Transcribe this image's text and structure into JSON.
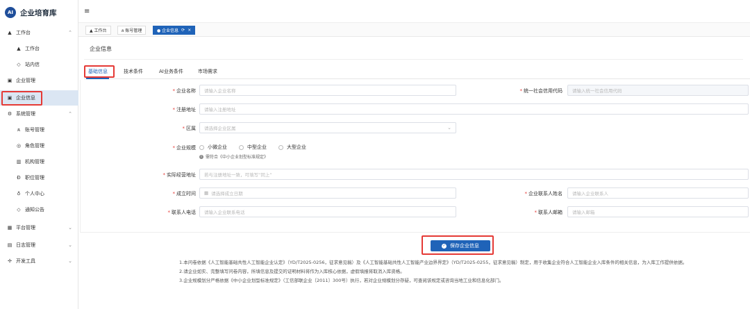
{
  "app": {
    "logo_mark": "AI",
    "title": "企业培育库"
  },
  "sidebar": {
    "items": [
      {
        "label": "工作台",
        "icon": "home-icon",
        "glyph": "▲",
        "chevron": "⌃"
      },
      {
        "label": "工作台",
        "icon": "home-icon",
        "glyph": "▲"
      },
      {
        "label": "站内信",
        "icon": "bell-icon",
        "glyph": "◇"
      },
      {
        "label": "企业管理",
        "icon": "id-card-icon",
        "glyph": "▣"
      },
      {
        "label": "企业信息",
        "icon": "id-card-icon",
        "glyph": "▣"
      },
      {
        "label": "系统管理",
        "icon": "gear-icon",
        "glyph": "⚙",
        "chevron": "⌃"
      },
      {
        "label": "账号管理",
        "icon": "user-icon",
        "glyph": "ጸ"
      },
      {
        "label": "角色管理",
        "icon": "role-icon",
        "glyph": "◎"
      },
      {
        "label": "机构管理",
        "icon": "org-icon",
        "glyph": "▥"
      },
      {
        "label": "职位管理",
        "icon": "position-icon",
        "glyph": "Ð"
      },
      {
        "label": "个人中心",
        "icon": "profile-icon",
        "glyph": "♁"
      },
      {
        "label": "通知公告",
        "icon": "notice-icon",
        "glyph": "◇"
      },
      {
        "label": "平台管理",
        "icon": "grid-icon",
        "glyph": "▦",
        "chevron": "⌄"
      },
      {
        "label": "日志管理",
        "icon": "log-icon",
        "glyph": "▤",
        "chevron": "⌄"
      },
      {
        "label": "开发工具",
        "icon": "tools-icon",
        "glyph": "✢",
        "chevron": "⌄"
      }
    ]
  },
  "topbar": {
    "menu_glyph": "≡"
  },
  "tabs": [
    {
      "label": "▲ 工作台"
    },
    {
      "label": "ጸ 账号管理"
    },
    {
      "label": "● 企业信息",
      "refresh": "⟳",
      "close": "×"
    }
  ],
  "page": {
    "title": "企业信息",
    "subtabs": [
      "基础信息",
      "技术条件",
      "AI业务条件",
      "市场需求"
    ]
  },
  "form": {
    "company_name": {
      "label": "企业名称",
      "placeholder": "请输入企业名称"
    },
    "credit_code": {
      "label": "统一社会信用代码",
      "placeholder": "请输入统一社会信用代码"
    },
    "reg_address": {
      "label": "注册地址",
      "placeholder": "请输入注册地址"
    },
    "district": {
      "label": "区属",
      "placeholder": "请选择企业区属",
      "arrow": "⌄"
    },
    "scale": {
      "label": "企业规模",
      "options": [
        "小微企业",
        "中型企业",
        "大型企业"
      ],
      "hint": "需符合《中小企业划型标准规定》",
      "hint_glyph": "i"
    },
    "actual_address": {
      "label": "实际经营地址",
      "placeholder": "若与注册地址一致，可填写“同上”"
    },
    "founded": {
      "label": "成立时间",
      "placeholder": "请选择成立日期",
      "glyph": "▦"
    },
    "contact_name": {
      "label": "企业联系人姓名",
      "placeholder": "请输入企业联系人"
    },
    "contact_phone": {
      "label": "联系人电话",
      "placeholder": "请输入企业联系电话"
    },
    "contact_email": {
      "label": "联系人邮箱",
      "placeholder": "请输入邮箱"
    },
    "required_mark": "*"
  },
  "actions": {
    "save_label": "保存企业信息",
    "save_glyph": "✓"
  },
  "notes": [
    "1.本问卷依据《人工智能基础共性人工智能企业认定》（YD/T2025-0256，征求意见稿）及《人工智能基础共性人工智能产业边界界定》（YD/T2025-0255，征求意见稿）制定，用于收集企业符合人工智能企业入库条件的相关信息，为入库工作提供依据。",
    "2.请企业如实、完整填写问卷内容，所填信息及提交的证明材料将作为入库核心依据，虚假填报将取消入库资格。",
    "3.企业规模划分严格依据《中小企业划型标准规定》（工信部联企业〔2011〕300号）执行，若对企业规模划分存疑，可查阅该规定或咨询当地工业和信息化部门。"
  ]
}
